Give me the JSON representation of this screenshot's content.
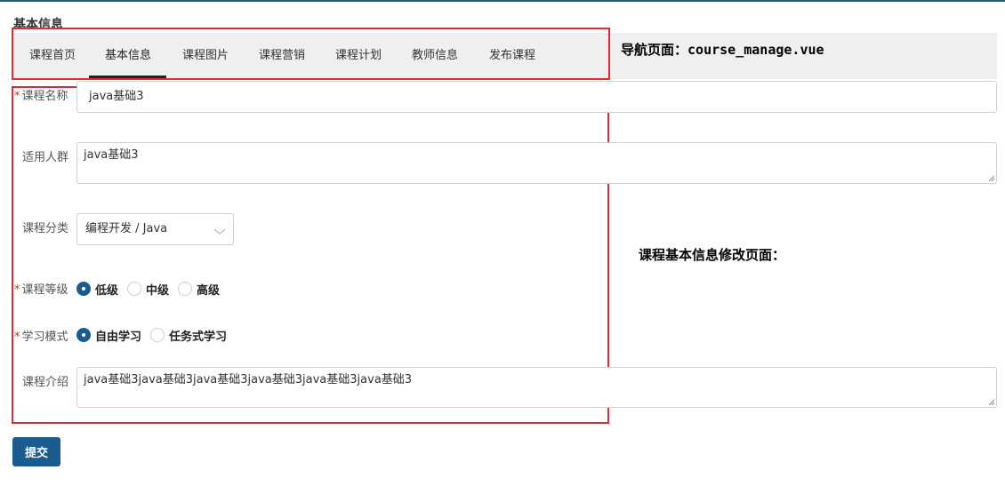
{
  "section_title": "基本信息",
  "tabs": [
    {
      "label": "课程首页",
      "active": false
    },
    {
      "label": "基本信息",
      "active": true
    },
    {
      "label": "课程图片",
      "active": false
    },
    {
      "label": "课程营销",
      "active": false
    },
    {
      "label": "课程计划",
      "active": false
    },
    {
      "label": "教师信息",
      "active": false
    },
    {
      "label": "发布课程",
      "active": false
    }
  ],
  "annotations": {
    "nav_prefix": "导航页面：",
    "nav_file": "course_manage.vue",
    "form_note": "课程基本信息修改页面："
  },
  "form": {
    "course_name": {
      "label": "课程名称",
      "required": true,
      "value": "java基础3"
    },
    "audience": {
      "label": "适用人群",
      "required": false,
      "value": "java基础3"
    },
    "category": {
      "label": "课程分类",
      "required": false,
      "value": "编程开发 / Java"
    },
    "grade": {
      "label": "课程等级",
      "required": true,
      "options": [
        "低级",
        "中级",
        "高级"
      ],
      "selected": "低级"
    },
    "study_mode": {
      "label": "学习模式",
      "required": true,
      "options": [
        "自由学习",
        "任务式学习"
      ],
      "selected": "自由学习"
    },
    "description": {
      "label": "课程介绍",
      "required": false,
      "value": "java基础3java基础3java基础3java基础3java基础3java基础3"
    }
  },
  "submit_label": "提交",
  "colors": {
    "primary": "#1b5c8e",
    "annotation_box": "#e8262d",
    "tab_bar": "#efefef",
    "required_star": "#e8262d"
  }
}
